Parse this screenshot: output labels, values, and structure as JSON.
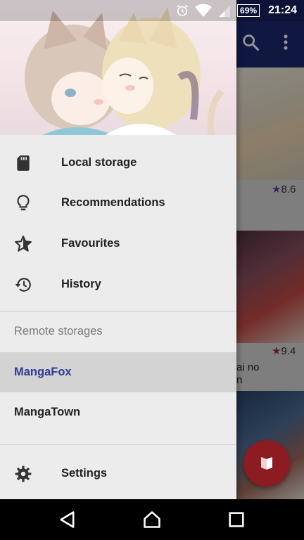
{
  "status_bar": {
    "battery": "69%",
    "time": "21:24"
  },
  "drawer": {
    "items": [
      {
        "label": "Local storage",
        "icon": "sd-card-icon"
      },
      {
        "label": "Recommendations",
        "icon": "lightbulb-icon"
      },
      {
        "label": "Favourites",
        "icon": "star-icon"
      },
      {
        "label": "History",
        "icon": "history-icon"
      }
    ],
    "section_title": "Remote storages",
    "remote": [
      {
        "label": "MangaFox",
        "selected": true
      },
      {
        "label": "MangaTown",
        "selected": false
      }
    ],
    "settings_label": "Settings"
  },
  "background": {
    "cards": [
      {
        "rating": "8.6",
        "star_color": "#5c3fa0"
      },
      {
        "rating": "9.4",
        "star_color": "#b0263b",
        "title_line1": "ai no",
        "title_line2": "n"
      }
    ]
  },
  "colors": {
    "accent": "#2f3a93",
    "toolbar": "#1d2a73",
    "fab": "#8c1b22"
  }
}
